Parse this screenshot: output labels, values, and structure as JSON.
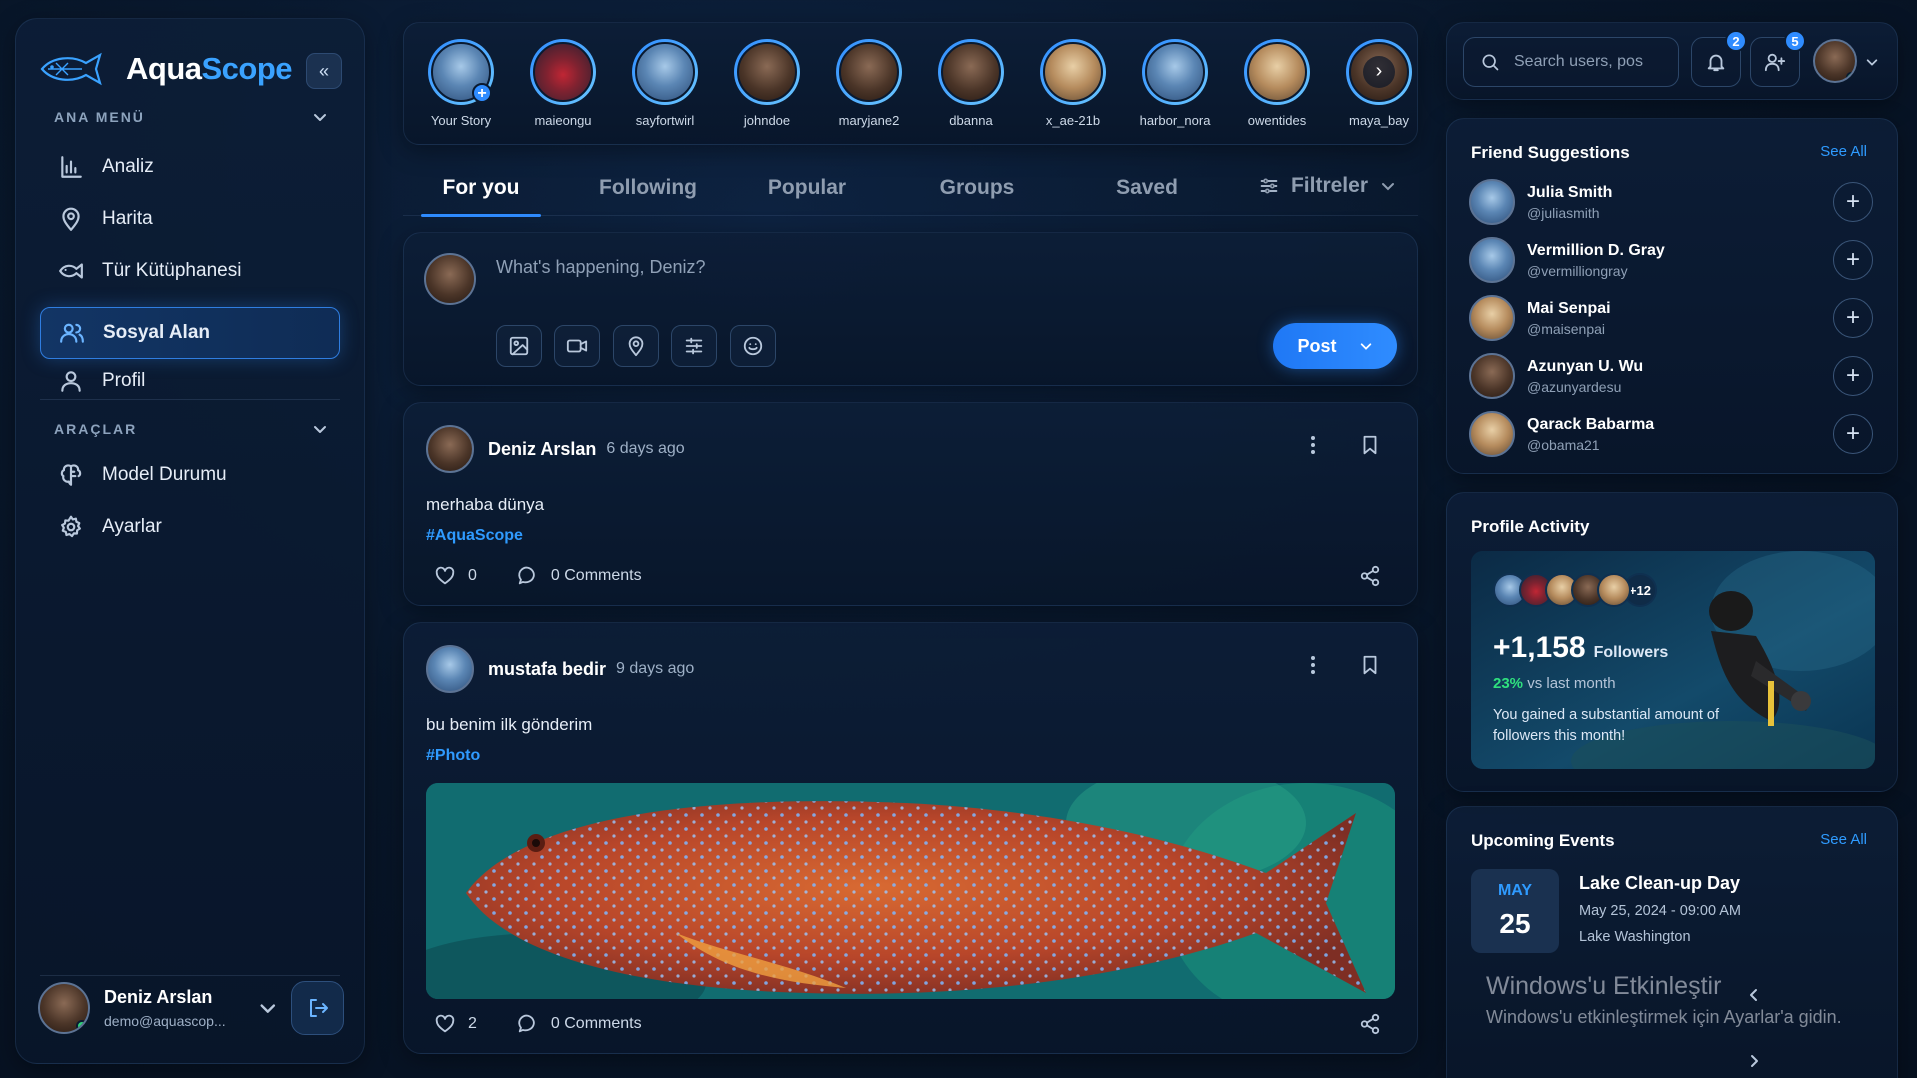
{
  "app": {
    "brand_part1": "Aqua",
    "brand_part2": "Scope",
    "collapse_icon": "double-chevron-left"
  },
  "sidebar": {
    "main_menu_label": "ANA MENÜ",
    "tools_label": "ARAÇLAR",
    "main_items": [
      {
        "label": "Analiz",
        "icon": "bar-chart-icon"
      },
      {
        "label": "Harita",
        "icon": "map-pin-icon"
      },
      {
        "label": "Tür Kütüphanesi",
        "icon": "fish-icon"
      },
      {
        "label": "Sosyal Alan",
        "icon": "users-icon",
        "active": true
      },
      {
        "label": "Profil",
        "icon": "user-icon"
      }
    ],
    "tool_items": [
      {
        "label": "Model Durumu",
        "icon": "brain-icon"
      },
      {
        "label": "Ayarlar",
        "icon": "gear-icon"
      }
    ],
    "user": {
      "name": "Deniz Arslan",
      "email": "demo@aquascop..."
    }
  },
  "stories": [
    {
      "name": "Your Story"
    },
    {
      "name": "maieongu"
    },
    {
      "name": "sayfortwirl"
    },
    {
      "name": "johndoe"
    },
    {
      "name": "maryjane2"
    },
    {
      "name": "dbanna"
    },
    {
      "name": "x_ae-21b"
    },
    {
      "name": "harbor_nora"
    },
    {
      "name": "owentides"
    },
    {
      "name": "maya_bay"
    }
  ],
  "tabs": [
    "For you",
    "Following",
    "Popular",
    "Groups",
    "Saved"
  ],
  "filter_label": "Filtreler",
  "composer": {
    "placeholder": "What's happening, Deniz?",
    "post_label": "Post"
  },
  "posts": [
    {
      "author": "Deniz Arslan",
      "time": "6 days ago",
      "text": "merhaba dünya",
      "tag": "#AquaScope",
      "likes": "0",
      "comments": "0 Comments"
    },
    {
      "author": "mustafa bedir",
      "time": "9 days ago",
      "text": "bu benim ilk gönderim",
      "tag": "#Photo",
      "likes": "2",
      "comments": "0 Comments"
    }
  ],
  "topbar": {
    "search_placeholder": "Search users, pos",
    "notif_count": "2",
    "friend_count": "5"
  },
  "suggestions": {
    "title": "Friend Suggestions",
    "see_all": "See All",
    "items": [
      {
        "name": "Julia Smith",
        "handle": "@juliasmith"
      },
      {
        "name": "Vermillion D. Gray",
        "handle": "@vermilliongray"
      },
      {
        "name": "Mai Senpai",
        "handle": "@maisenpai"
      },
      {
        "name": "Azunyan U. Wu",
        "handle": "@azunyardesu"
      },
      {
        "name": "Qarack Babarma",
        "handle": "@obama21"
      }
    ]
  },
  "activity": {
    "title": "Profile Activity",
    "more": "+12",
    "count": "+1,158",
    "count_label": "Followers",
    "pct": "23%",
    "pct_label": "vs last month",
    "message": "You gained a substantial amount of followers this month!"
  },
  "events": {
    "title": "Upcoming Events",
    "see_all": "See All",
    "month": "MAY",
    "day": "25",
    "name": "Lake Clean-up Day",
    "when": "May 25, 2024 - 09:00 AM",
    "where": "Lake Washington"
  },
  "watermark": {
    "line1": "Windows'u Etkinleştir",
    "line2": "Windows'u etkinleştirmek için Ayarlar'a gidin."
  },
  "colors": {
    "accent": "#2f8cff",
    "positive": "#2fe07e",
    "bg": "#081629"
  }
}
